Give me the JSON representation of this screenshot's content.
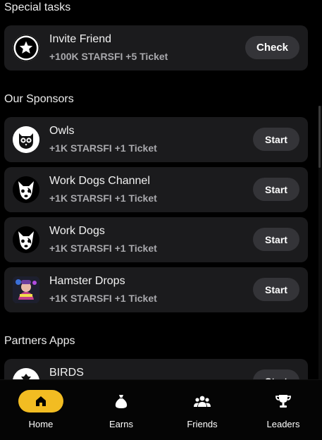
{
  "special_tasks": {
    "title": "Special tasks",
    "item": {
      "title": "Invite Friend",
      "reward": "+100K STARSFI +5 Ticket",
      "button": "Check",
      "icon": "star-icon"
    }
  },
  "sponsors": {
    "title": "Our Sponsors",
    "items": [
      {
        "title": "Owls",
        "reward": "+1K STARSFI +1 Ticket",
        "button": "Start",
        "icon": "owl-icon"
      },
      {
        "title": "Work Dogs Channel",
        "reward": "+1K STARSFI +1 Ticket",
        "button": "Start",
        "icon": "dog-icon"
      },
      {
        "title": "Work Dogs",
        "reward": "+1K STARSFI +1 Ticket",
        "button": "Start",
        "icon": "dog-icon"
      },
      {
        "title": "Hamster Drops",
        "reward": "+1K STARSFI +1 Ticket",
        "button": "Start",
        "icon": "hamster-icon"
      }
    ]
  },
  "partners": {
    "title": "Partners Apps",
    "items": [
      {
        "title": "BIRDS",
        "button": "Start",
        "icon": "bird-icon"
      }
    ]
  },
  "nav": {
    "active_color": "#f2bc22",
    "items": [
      {
        "label": "Home",
        "icon": "home-icon",
        "active": true
      },
      {
        "label": "Earns",
        "icon": "money-bag-icon",
        "active": false
      },
      {
        "label": "Friends",
        "icon": "friends-icon",
        "active": false
      },
      {
        "label": "Leaders",
        "icon": "trophy-icon",
        "active": false
      }
    ]
  }
}
